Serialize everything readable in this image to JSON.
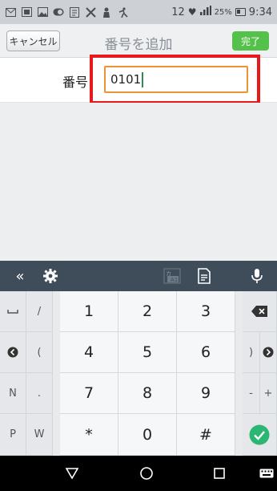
{
  "status_bar": {
    "time": "9:34",
    "battery_percent": "25%",
    "badge_count": "12",
    "notification_icons": [
      "mail-icon",
      "image-icon",
      "photo-icon",
      "toggle-icon",
      "memo-icon",
      "tools-icon",
      "person-icon",
      "accessibility-icon"
    ]
  },
  "header": {
    "cancel_label": "キャンセル",
    "title": "番号を追加",
    "done_label": "完了"
  },
  "form": {
    "label": "番号",
    "value": "0101"
  },
  "keyboard": {
    "toolbar": {
      "collapse": "«",
      "icons": [
        "settings-icon",
        "kana-conversion-icon",
        "clipboard-icon",
        "microphone-icon"
      ]
    },
    "left_keys": [
      [
        "—",
        "/"
      ],
      [
        "◀",
        "("
      ],
      [
        "N",
        "."
      ],
      [
        "P",
        "W"
      ]
    ],
    "digits": [
      [
        "1",
        "2",
        "3"
      ],
      [
        "4",
        "5",
        "6"
      ],
      [
        "7",
        "8",
        "9"
      ],
      [
        "*",
        "0",
        "#"
      ]
    ],
    "right_keys": [
      ")",
      "-",
      "+"
    ]
  },
  "colors": {
    "accent_green": "#54c24a",
    "input_border": "#f0922f",
    "highlight_red": "#e8191b",
    "toolbar_bg": "#3f4c59",
    "check_teal": "#2bb673"
  }
}
